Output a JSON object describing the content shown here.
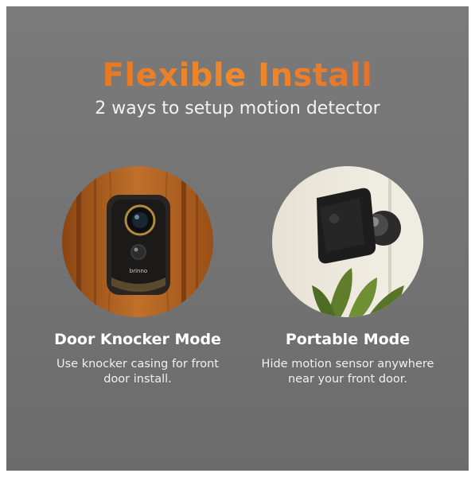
{
  "header": {
    "title": "Flexible Install",
    "subtitle": "2 ways to setup motion detector"
  },
  "modes": [
    {
      "title": "Door Knocker Mode",
      "description_line1": "Use knocker casing for front",
      "description_line2": "door install.",
      "image_icon": "door-knocker-camera-photo"
    },
    {
      "title": "Portable Mode",
      "description_line1": "Hide motion sensor anywhere",
      "description_line2": "near your front door.",
      "image_icon": "wall-mounted-camera-photo"
    }
  ],
  "brand_mark": "brinno",
  "colors": {
    "title_accent": "#e8741f",
    "panel": "#757575",
    "wood": "#b5601f",
    "device": "#222222"
  }
}
